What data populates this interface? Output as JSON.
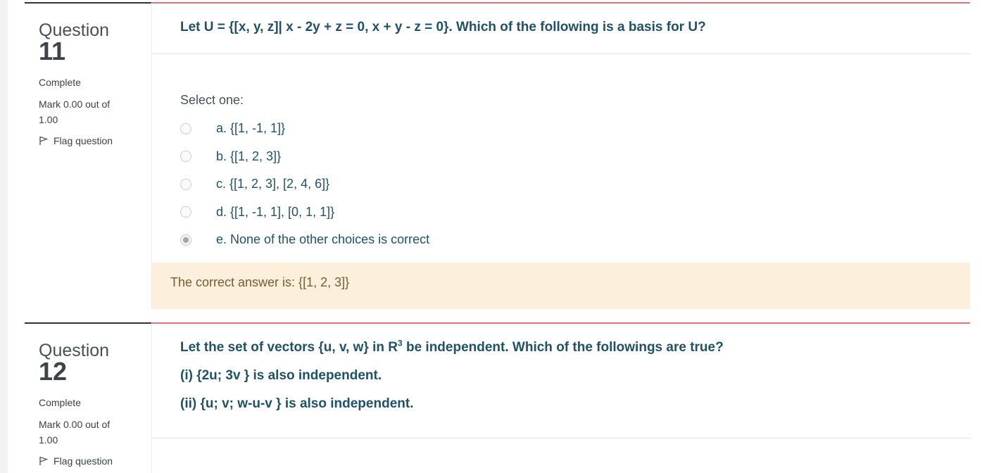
{
  "questions": [
    {
      "title": "Question",
      "number": "11",
      "state": "Complete",
      "grade": "Mark 0.00 out of 1.00",
      "flag_label": "Flag question",
      "text": [
        "Let U = {[x, y, z]| x - 2y + z = 0, x + y - z = 0}. Which of the following is a basis for U?"
      ],
      "prompt": "Select one:",
      "options": [
        {
          "label": "a. {[1, -1, 1]}",
          "checked": false
        },
        {
          "label": "b. {[1, 2, 3]}",
          "checked": false
        },
        {
          "label": "c. {[1, 2, 3], [2, 4, 6]}",
          "checked": false
        },
        {
          "label": "d. {[1, -1, 1], [0, 1, 1]}",
          "checked": false
        },
        {
          "label": "e. None of the other choices is correct",
          "checked": true
        }
      ],
      "feedback": "The correct answer is: {[1, 2, 3]}"
    },
    {
      "title": "Question",
      "number": "12",
      "state": "Complete",
      "grade": "Mark 0.00 out of 1.00",
      "flag_label": "Flag question",
      "text_line1_before": "Let the set of vectors {u, v, w} in R",
      "text_line1_sup": "3",
      "text_line1_after": " be independent. Which of the followings are true?",
      "text_line2": "(i) {2u; 3v } is also independent.",
      "text_line3": "(ii) {u; v; w-u-v } is also independent."
    }
  ],
  "colors": {
    "accent_border": "#e8707c",
    "question_text": "#1f5167",
    "feedback_bg": "#fcefdc"
  }
}
